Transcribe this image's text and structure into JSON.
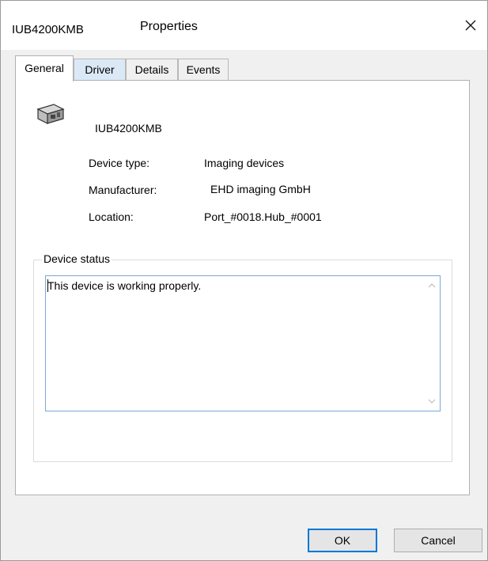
{
  "window": {
    "device_title": "IUB4200KMB",
    "title": "Properties"
  },
  "tabs": [
    {
      "label": "General",
      "active": true
    },
    {
      "label": "Driver",
      "active": false
    },
    {
      "label": "Details",
      "active": false
    },
    {
      "label": "Events",
      "active": false
    }
  ],
  "general": {
    "device_name": "IUB4200KMB",
    "device_type_label": "Device type:",
    "device_type_value": "Imaging devices",
    "manufacturer_label": "Manufacturer:",
    "manufacturer_value": "EHD imaging GmbH",
    "location_label": "Location:",
    "location_value": "Port_#0018.Hub_#0001",
    "status_group_label": "Device status",
    "status_text": "This device is working properly."
  },
  "buttons": {
    "ok": "OK",
    "cancel": "Cancel"
  },
  "icons": {
    "close": "close-icon",
    "device": "imaging-device-icon",
    "scroll_up": "chevron-up-icon",
    "scroll_down": "chevron-down-icon"
  },
  "colors": {
    "accent": "#0078d7",
    "focus_border": "#7aa7d8",
    "dialog_bg": "#f0f0f0"
  }
}
